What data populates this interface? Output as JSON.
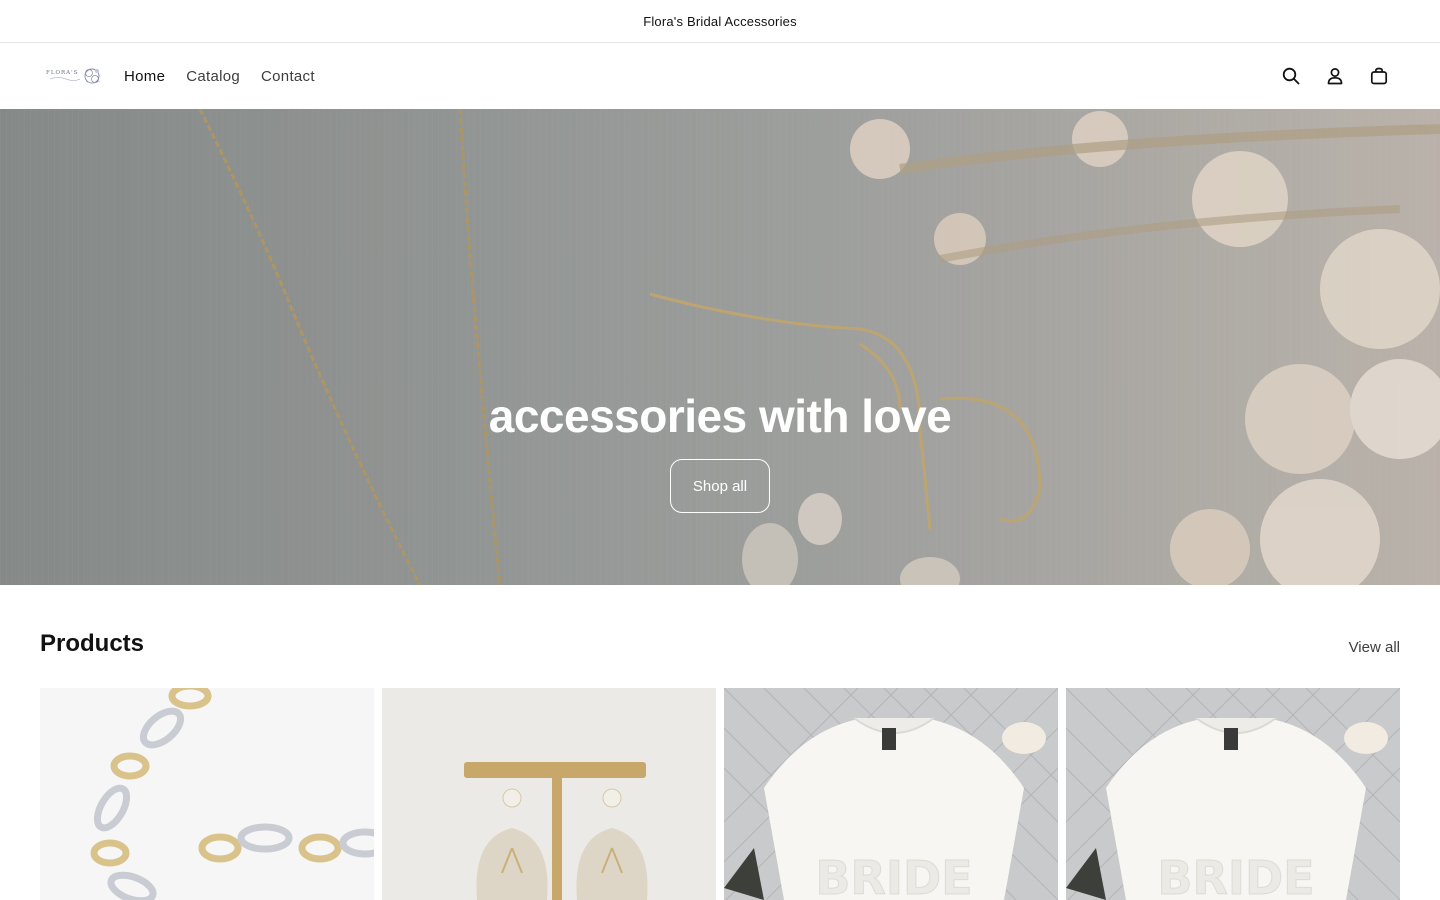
{
  "announcement": {
    "text": "Flora's Bridal Accessories"
  },
  "header": {
    "logo_text": "FLORA'S",
    "nav": [
      {
        "label": "Home",
        "active": true
      },
      {
        "label": "Catalog",
        "active": false
      },
      {
        "label": "Contact",
        "active": false
      }
    ],
    "icons": [
      "search-icon",
      "account-icon",
      "cart-icon"
    ]
  },
  "hero": {
    "title": "accessories with love",
    "button_label": "Shop all"
  },
  "products": {
    "heading": "Products",
    "view_all_label": "View all",
    "items": [
      {
        "image": "gold-silver-chain-necklace"
      },
      {
        "image": "pearl-leaf-drop-earrings-on-stand"
      },
      {
        "image": "white-bride-sweatshirt"
      },
      {
        "image": "white-bride-sweatshirt"
      }
    ]
  },
  "colors": {
    "text": "#121212",
    "muted_text": "#3d3d3d",
    "border": "#e6e6e6",
    "hero_text": "#ffffff"
  }
}
